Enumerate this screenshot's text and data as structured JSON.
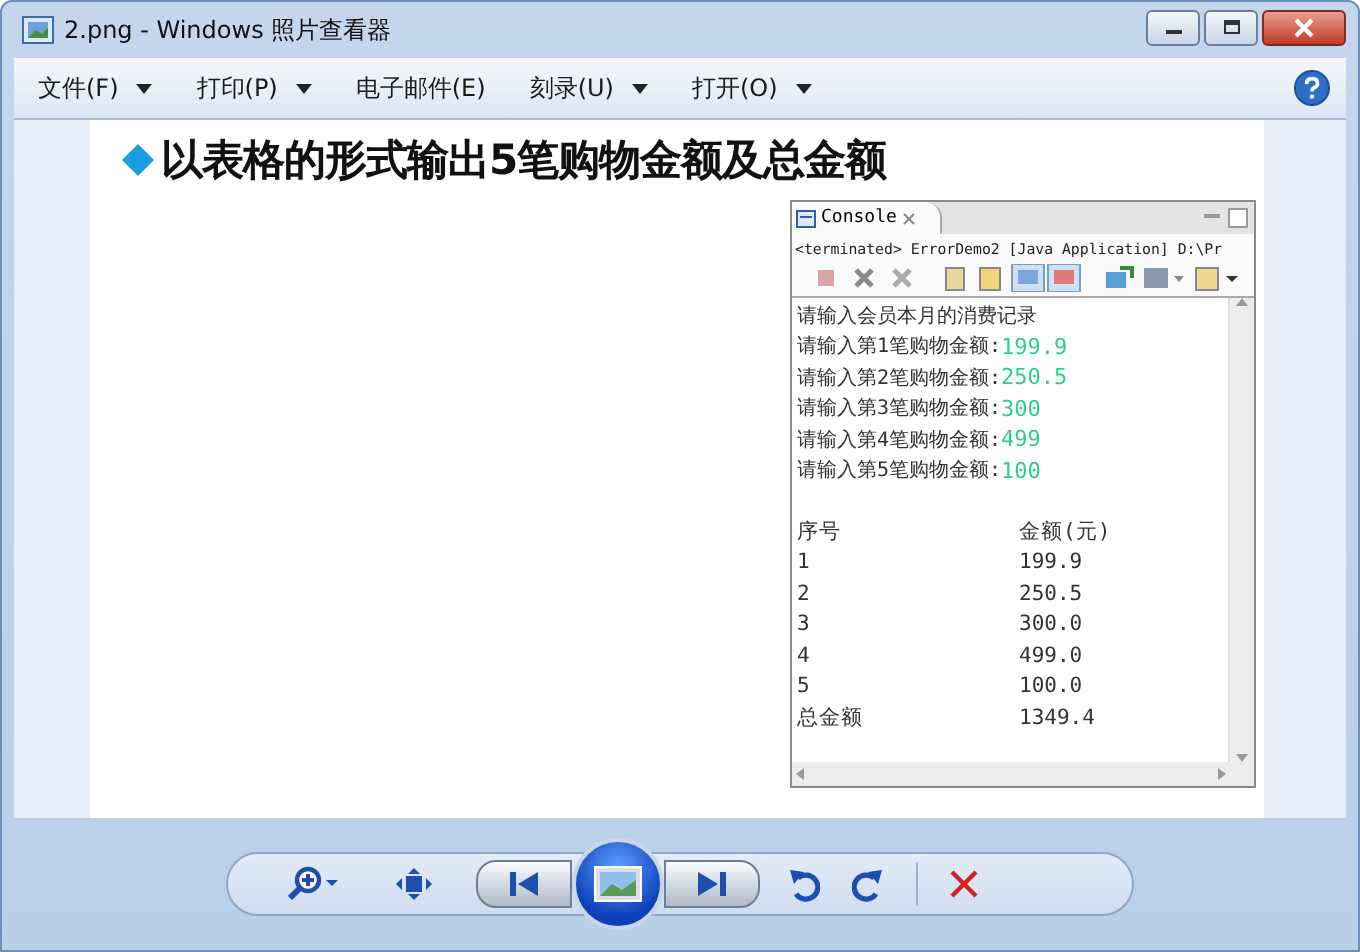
{
  "window": {
    "title": "2.png - Windows 照片查看器"
  },
  "menu": [
    {
      "label": "文件(F)",
      "dropdown": true
    },
    {
      "label": "打印(P)",
      "dropdown": true
    },
    {
      "label": "电子邮件(E)",
      "dropdown": false
    },
    {
      "label": "刻录(U)",
      "dropdown": true
    },
    {
      "label": "打开(O)",
      "dropdown": true
    }
  ],
  "slide": {
    "heading": "以表格的形式输出5笔购物金额及总金额",
    "console": {
      "tab": "Console",
      "header": "<terminated> ErrorDemo2 [Java Application] D:\\Pr",
      "intro": "请输入会员本月的消费记录",
      "inputs": [
        {
          "label": "请输入第1笔购物金额:",
          "value": "199.9"
        },
        {
          "label": "请输入第2笔购物金额:",
          "value": "250.5"
        },
        {
          "label": "请输入第3笔购物金额:",
          "value": "300"
        },
        {
          "label": "请输入第4笔购物金额:",
          "value": "499"
        },
        {
          "label": "请输入第5笔购物金额:",
          "value": "100"
        }
      ],
      "columns": [
        "序号",
        "金额(元)"
      ],
      "rows": [
        [
          "1",
          "199.9"
        ],
        [
          "2",
          "250.5"
        ],
        [
          "3",
          "300.0"
        ],
        [
          "4",
          "499.0"
        ],
        [
          "5",
          "100.0"
        ],
        [
          "总金额",
          "1349.4"
        ]
      ]
    }
  }
}
